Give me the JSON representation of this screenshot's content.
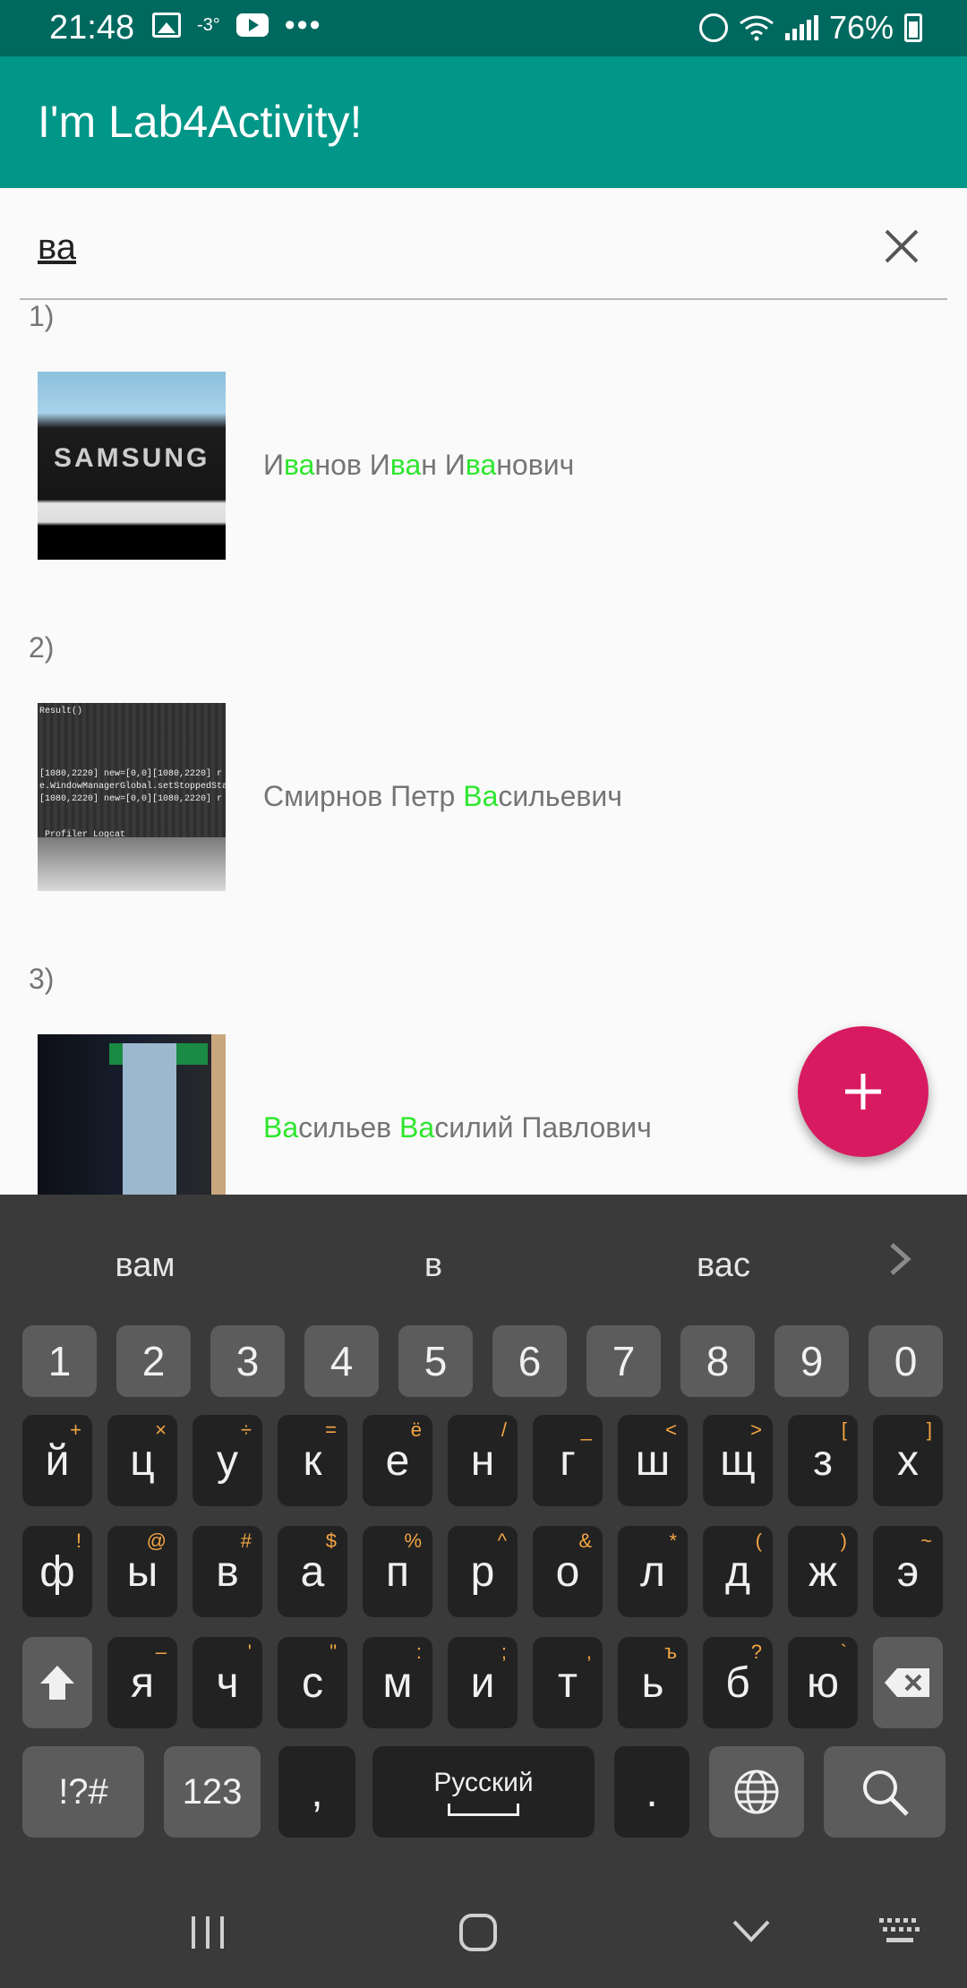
{
  "status_bar": {
    "time": "21:48",
    "temperature": "-3°",
    "battery": "76%"
  },
  "app_bar": {
    "title": "I'm Lab4Activity!"
  },
  "search": {
    "query": "ва",
    "clear_icon": "close-icon"
  },
  "list": {
    "items": [
      {
        "index": "1)",
        "name_parts": [
          {
            "t": "И",
            "hl": false
          },
          {
            "t": "ва",
            "hl": true
          },
          {
            "t": "нов И",
            "hl": false
          },
          {
            "t": "ва",
            "hl": true
          },
          {
            "t": "н И",
            "hl": false
          },
          {
            "t": "ва",
            "hl": true
          },
          {
            "t": "нович",
            "hl": false
          }
        ],
        "thumb_text": "SAMSUNG"
      },
      {
        "index": "2)",
        "name_parts": [
          {
            "t": "Смирнов Петр ",
            "hl": false
          },
          {
            "t": "Ва",
            "hl": true
          },
          {
            "t": "сильевич",
            "hl": false
          }
        ],
        "thumb_lines": [
          "Result()",
          "[1080,2220] new=[0,0][1080,2220] r",
          "e.WindowManagerGlobal.setStoppedSta",
          "[1080,2220] new=[0,0][1080,2220] r",
          "Profiler     Logcat"
        ]
      },
      {
        "index": "3)",
        "name_parts": [
          {
            "t": "Ва",
            "hl": true
          },
          {
            "t": "сильев ",
            "hl": false
          },
          {
            "t": "Ва",
            "hl": true
          },
          {
            "t": "силий Павлович",
            "hl": false
          }
        ]
      }
    ],
    "highlight_color": "#2ee62e"
  },
  "fab": {
    "icon": "plus-icon",
    "color": "#d81b60"
  },
  "keyboard": {
    "suggestions": [
      "вам",
      "в",
      "вас"
    ],
    "number_row": [
      "1",
      "2",
      "3",
      "4",
      "5",
      "6",
      "7",
      "8",
      "9",
      "0"
    ],
    "row1": [
      {
        "k": "й",
        "s": "+"
      },
      {
        "k": "ц",
        "s": "×"
      },
      {
        "k": "у",
        "s": "÷"
      },
      {
        "k": "к",
        "s": "="
      },
      {
        "k": "е",
        "s": "ё"
      },
      {
        "k": "н",
        "s": "/"
      },
      {
        "k": "г",
        "s": "_"
      },
      {
        "k": "ш",
        "s": "<"
      },
      {
        "k": "щ",
        "s": ">"
      },
      {
        "k": "з",
        "s": "["
      },
      {
        "k": "х",
        "s": "]"
      }
    ],
    "row2": [
      {
        "k": "ф",
        "s": "!"
      },
      {
        "k": "ы",
        "s": "@"
      },
      {
        "k": "в",
        "s": "#"
      },
      {
        "k": "а",
        "s": "$"
      },
      {
        "k": "п",
        "s": "%"
      },
      {
        "k": "р",
        "s": "^"
      },
      {
        "k": "о",
        "s": "&"
      },
      {
        "k": "л",
        "s": "*"
      },
      {
        "k": "д",
        "s": "("
      },
      {
        "k": "ж",
        "s": ")"
      },
      {
        "k": "э",
        "s": "~"
      }
    ],
    "row3": [
      {
        "k": "я",
        "s": "–"
      },
      {
        "k": "ч",
        "s": "'"
      },
      {
        "k": "с",
        "s": "\""
      },
      {
        "k": "м",
        "s": ":"
      },
      {
        "k": "и",
        "s": ";"
      },
      {
        "k": "т",
        "s": ","
      },
      {
        "k": "ь",
        "s": "ъ"
      },
      {
        "k": "б",
        "s": "?"
      },
      {
        "k": "ю",
        "s": "`"
      }
    ],
    "bottom": {
      "symbols": "!?#",
      "numbers": "123",
      "comma": ",",
      "language": "Русский",
      "period": "."
    }
  },
  "colors": {
    "status_bar": "#00695f",
    "app_bar": "#009688",
    "keyboard_bg": "#3a3a3a"
  }
}
